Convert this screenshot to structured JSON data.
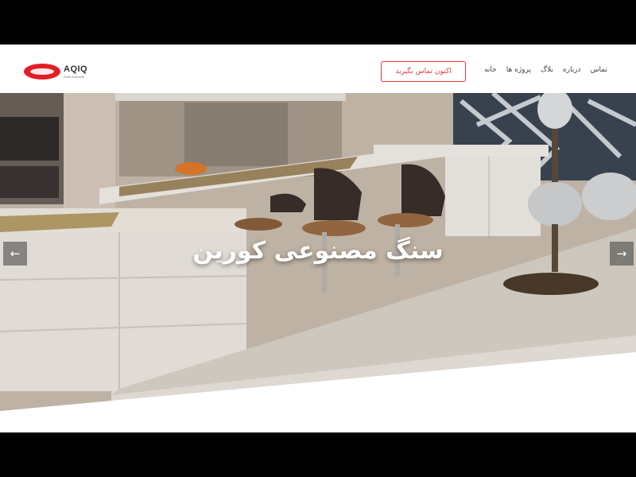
{
  "brand": {
    "name": "AQIQ",
    "tagline": "Solid Surfaces",
    "color": "#e31e24"
  },
  "header": {
    "cta_label": "اکنون تماس بگیرید",
    "nav": [
      {
        "label": "خانه"
      },
      {
        "label": "پروژه ها"
      },
      {
        "label": "بلاگ"
      },
      {
        "label": "درباره"
      },
      {
        "label": "تماس"
      }
    ]
  },
  "hero": {
    "title": "سنگ مصنوعی کورین",
    "prev_icon": "arrow-left-icon",
    "next_icon": "arrow-right-icon"
  },
  "colors": {
    "accent": "#e53935",
    "text": "#444444"
  }
}
